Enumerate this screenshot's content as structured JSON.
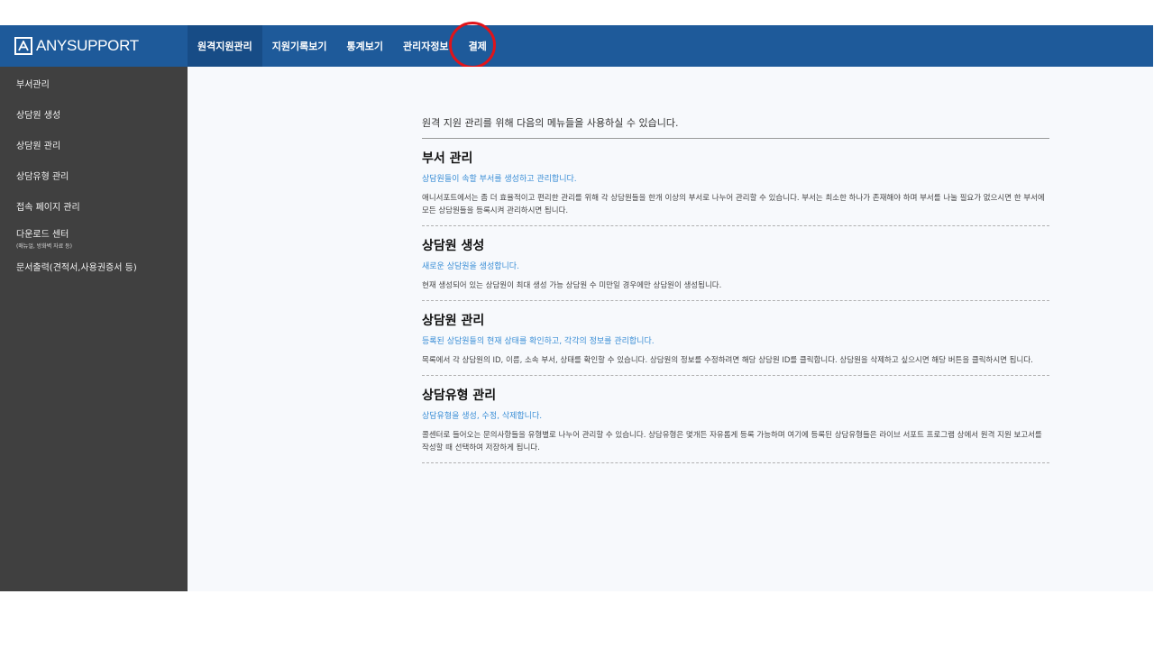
{
  "header": {
    "logo_text": "ANYSUPPORT",
    "nav": [
      {
        "label": "원격지원관리",
        "active": true
      },
      {
        "label": "지원기록보기"
      },
      {
        "label": "통계보기"
      },
      {
        "label": "관리자정보"
      },
      {
        "label": "결제",
        "highlighted": true
      }
    ]
  },
  "sidebar": {
    "items": [
      {
        "label": "부서관리"
      },
      {
        "label": "상담원 생성"
      },
      {
        "label": "상담원 관리"
      },
      {
        "label": "상담유형 관리"
      },
      {
        "label": "접속 페이지 관리"
      },
      {
        "label": "다운로드 센터",
        "sub": "(매뉴얼, 방화벽 자료 등)"
      },
      {
        "label": "문서출력(견적서,사용권증서 등)"
      }
    ]
  },
  "main": {
    "intro": "원격 지원 관리를 위해 다음의 메뉴들을 사용하실 수 있습니다.",
    "sections": [
      {
        "title": "부서 관리",
        "subtitle": "상담원들이 속할 부서를 생성하고 관리합니다.",
        "description": "애니서포트에서는 좀 더 효율적이고 편리한 관리를 위해 각 상담원들을 한개 이상의 부서로 나누어 관리할 수 있습니다. 부서는 최소한 하나가 존재해야 하며 부서를 나눌 필요가 없으시면 한 부서에 모든 상담원들을 등록시켜 관리하시면 됩니다."
      },
      {
        "title": "상담원 생성",
        "subtitle": "새로운 상담원을 생성합니다.",
        "description": "현재 생성되어 있는 상담원이 최대 생성 가능 상담원 수 미만일 경우에만 상담원이 생성됩니다."
      },
      {
        "title": "상담원 관리",
        "subtitle": "등록된 상담원들의 현재 상태를 확인하고, 각각의 정보를 관리합니다.",
        "description": "목록에서 각 상담원의 ID, 이름, 소속 부서, 상태를 확인할 수 있습니다. 상담원의 정보를 수정하려면 해당 상담원 ID를 클릭합니다. 상담원을 삭제하고 싶으시면 해당 버튼을 클릭하시면 됩니다."
      },
      {
        "title": "상담유형 관리",
        "subtitle": "상담유형을 생성, 수정, 삭제합니다.",
        "description": "콜센터로 들어오는 문의사항들을 유형별로 나누어 관리할 수 있습니다. 상담유형은 몇개든 자유롭게 등록 가능하며 여기에 등록된 상담유형들은 라이브 서포트 프로그램 상에서 원격 지원 보고서를 작성할 때 선택하여 저장하게 됩니다."
      }
    ]
  },
  "colors": {
    "header_bg": "#1e5a9a",
    "sidebar_bg": "#404040",
    "subtitle": "#3a8ed6",
    "highlight_ring": "#e0141a"
  }
}
